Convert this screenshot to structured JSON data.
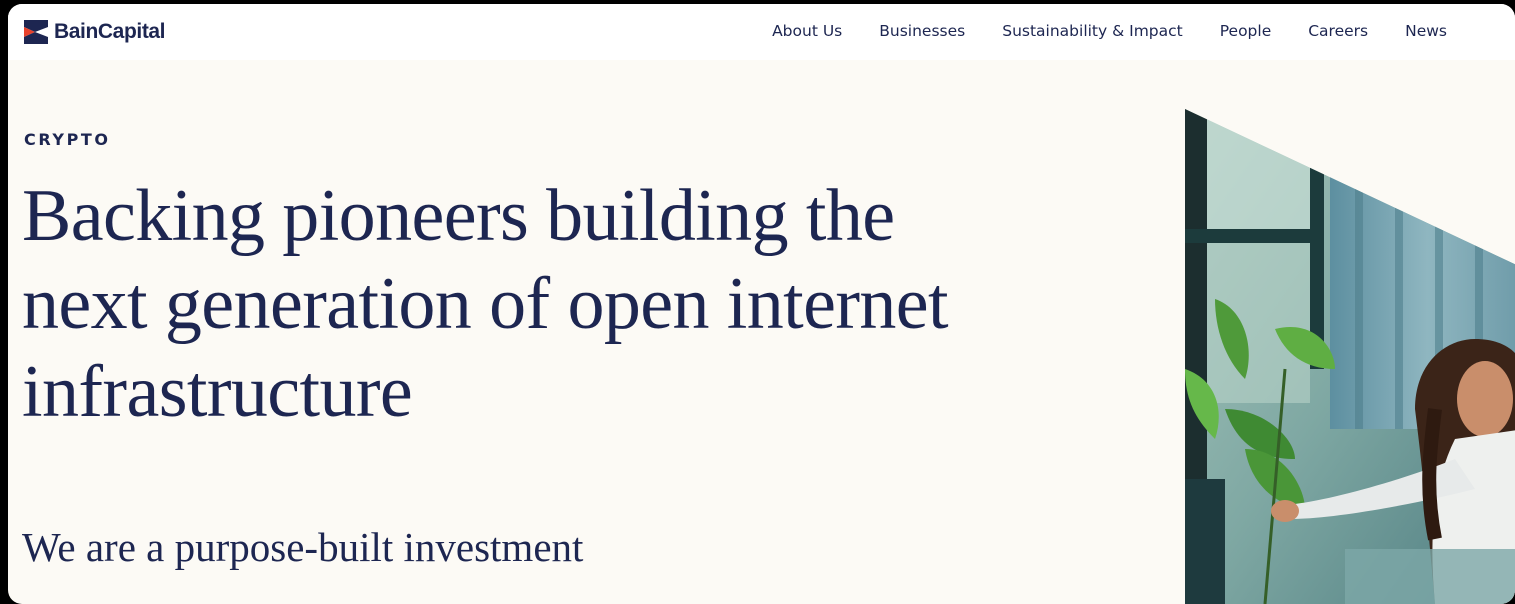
{
  "header": {
    "logo_text": "BainCapital",
    "nav": [
      "About Us",
      "Businesses",
      "Sustainability & Impact",
      "People",
      "Careers",
      "News"
    ]
  },
  "hero": {
    "eyebrow": "CRYPTO",
    "headline_lines": [
      "Backing pioneers building the",
      "next generation of open internet",
      "infrastructure"
    ],
    "subhead": "We are a purpose-built investment"
  },
  "colors": {
    "brand_navy": "#1d2651",
    "brand_red": "#e8422c",
    "page_background": "#fcfaf5"
  },
  "image": {
    "icon": "woman-at-office-photo"
  }
}
